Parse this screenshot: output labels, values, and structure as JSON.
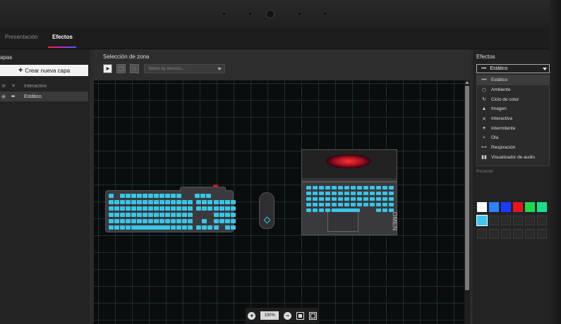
{
  "tabs": [
    {
      "label": "Presentación",
      "active": false
    },
    {
      "label": "Efectos",
      "active": true
    }
  ],
  "layers_panel": {
    "title": "apas",
    "create_button": "Crear nueva capa",
    "items": [
      {
        "label": "Interactivo",
        "selected": false
      },
      {
        "label": "Estático",
        "selected": true
      }
    ]
  },
  "zone_panel": {
    "title": "Selección de zona",
    "tools": [
      "pointer-select-icon",
      "box-select-icon",
      "lasso-select-icon"
    ],
    "device_select": {
      "placeholder": "Select by devices..."
    },
    "zoom": {
      "value": "100%"
    }
  },
  "effects_panel": {
    "title": "Efectos",
    "selected": "Estático",
    "options": [
      {
        "label": "Estático",
        "icon": "dots-icon"
      },
      {
        "label": "Ambiente",
        "icon": "cube-icon"
      },
      {
        "label": "Ciclo de color",
        "icon": "cycle-icon"
      },
      {
        "label": "Imagen",
        "icon": "image-icon"
      },
      {
        "label": "Interactiva",
        "icon": "interactive-icon"
      },
      {
        "label": "Intermitente",
        "icon": "sparkle-icon"
      },
      {
        "label": "Ola",
        "icon": "wave-icon"
      },
      {
        "label": "Respiración",
        "icon": "breathing-icon"
      },
      {
        "label": "Visualizador de audio",
        "icon": "audio-bars-icon"
      }
    ],
    "recent_label": "Reciente",
    "swatches": [
      "#ffffff",
      "#2f80ff",
      "#1a3cff",
      "#e8141c",
      "#1ed84b",
      "#19e08a",
      "#3cc8f0"
    ],
    "key_color": "#38c6e8",
    "accent": "#e82234"
  },
  "devices": {
    "laptop_logo": "OMEN"
  }
}
